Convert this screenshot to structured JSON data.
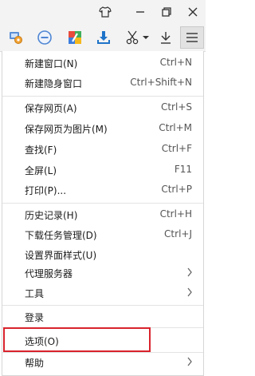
{
  "toolbar": {
    "icons": [
      "tools-icon",
      "minus-circle-icon",
      "app-center-icon",
      "download-icon",
      "scissors-icon",
      "dropdown-arrow-icon",
      "download-arrow-icon",
      "menu-icon"
    ]
  },
  "window_controls": [
    "skin-icon",
    "minimize-icon",
    "restore-icon",
    "close-icon"
  ],
  "menu": {
    "items": [
      {
        "label": "新建窗口(N)",
        "shortcut": "Ctrl+N"
      },
      {
        "label": "新建隐身窗口",
        "shortcut": "Ctrl+Shift+N"
      },
      {
        "label": "保存网页(A)",
        "shortcut": "Ctrl+S"
      },
      {
        "label": "保存网页为图片(M)",
        "shortcut": "Ctrl+M"
      },
      {
        "label": "查找(F)",
        "shortcut": "Ctrl+F"
      },
      {
        "label": "全屏(L)",
        "shortcut": "F11"
      },
      {
        "label": "打印(P)...",
        "shortcut": "Ctrl+P"
      },
      {
        "label": "历史记录(H)",
        "shortcut": "Ctrl+H"
      },
      {
        "label": "下载任务管理(D)",
        "shortcut": "Ctrl+J"
      },
      {
        "label": "设置界面样式(U)",
        "shortcut": ""
      },
      {
        "label": "代理服务器",
        "shortcut": ""
      },
      {
        "label": "工具",
        "shortcut": ""
      },
      {
        "label": "登录",
        "shortcut": ""
      },
      {
        "label": "选项(O)",
        "shortcut": ""
      },
      {
        "label": "帮助",
        "shortcut": ""
      }
    ]
  },
  "colors": {
    "highlight_border": "#d9232d",
    "download_blue": "#1e73c8"
  }
}
